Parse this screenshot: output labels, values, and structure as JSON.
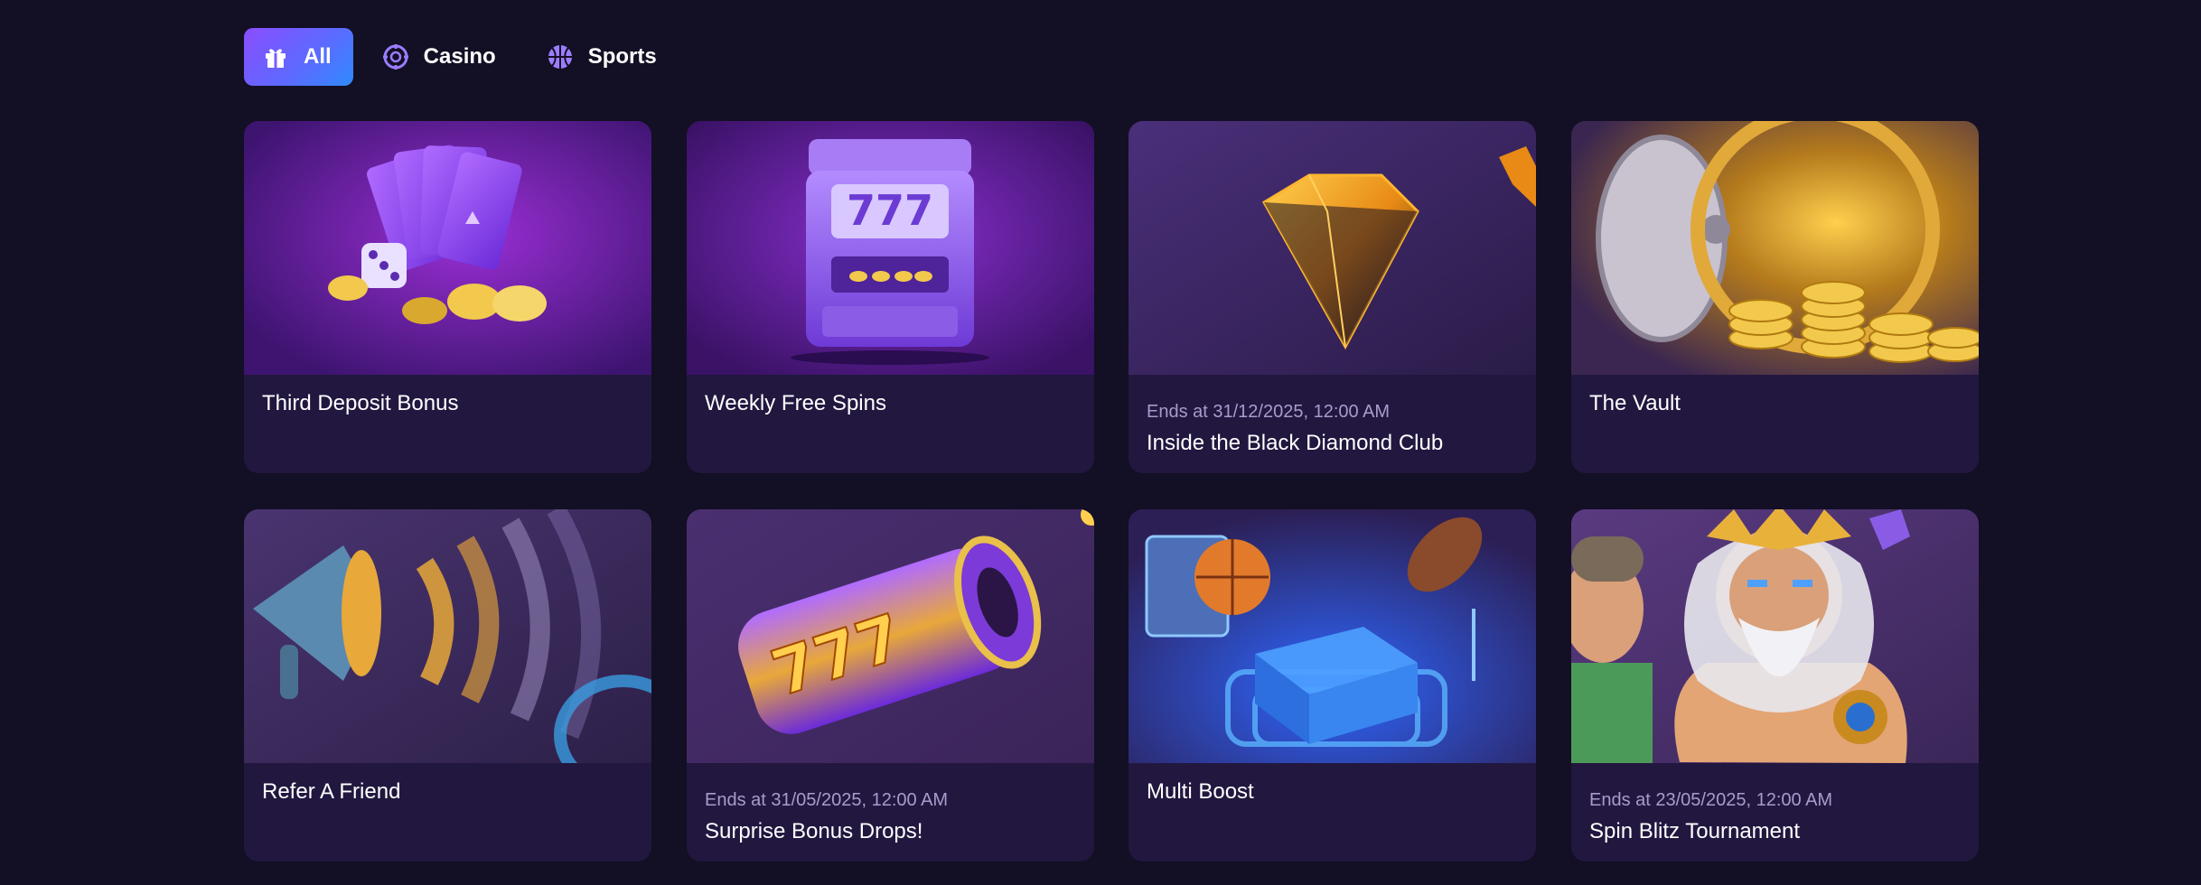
{
  "tabs": [
    {
      "label": "All",
      "icon": "gift-icon",
      "active": true
    },
    {
      "label": "Casino",
      "icon": "casino-chip-icon",
      "active": false
    },
    {
      "label": "Sports",
      "icon": "basketball-icon",
      "active": false
    }
  ],
  "colors": {
    "background": "#130f24",
    "card": "#22173f",
    "accent_start": "#8a4dff",
    "accent_end": "#2e8bff",
    "muted_text": "#a79ccc"
  },
  "promotions": [
    {
      "title": "Third Deposit Bonus",
      "ends": "",
      "image": "cards-dice-coins"
    },
    {
      "title": "Weekly Free Spins",
      "ends": "",
      "image": "slot-machine-777"
    },
    {
      "title": "Inside the Black Diamond Club",
      "ends": "Ends at 31/12/2025, 12:00 AM",
      "image": "black-diamond"
    },
    {
      "title": "The Vault",
      "ends": "",
      "image": "vault-gold-coins"
    },
    {
      "title": "Refer A Friend",
      "ends": "",
      "image": "megaphone"
    },
    {
      "title": "Surprise Bonus Drops!",
      "ends": "Ends at 31/05/2025, 12:00 AM",
      "image": "slot-reel-777"
    },
    {
      "title": "Multi Boost",
      "ends": "",
      "image": "sports-gift-box"
    },
    {
      "title": "Spin Blitz Tournament",
      "ends": "Ends at 23/05/2025, 12:00 AM",
      "image": "zeus-characters"
    }
  ]
}
